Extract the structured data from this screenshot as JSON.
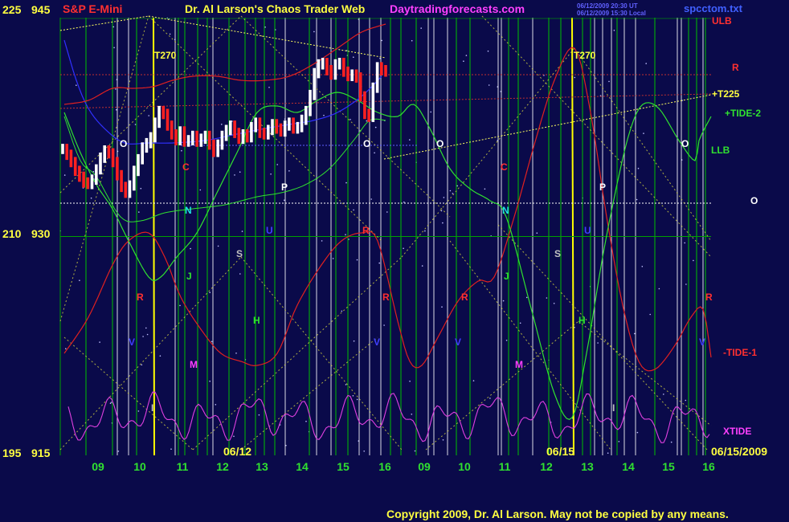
{
  "header": {
    "title_left": "S&P E-Mini",
    "title_center": "Dr. Al Larson's Chaos Trader Web",
    "site": "Daytradingforecasts.com",
    "timestamp_utc": "06/12/2009 20:30 UT",
    "timestamp_local": "06/12/2009 15:30 Local",
    "file": "spcctom.txt"
  },
  "footer": {
    "copyright": "Copyright 2009, Dr. Al Larson. May not be copied by any means."
  },
  "colors": {
    "background": "#0a0a4a",
    "price_up": "#ffffff",
    "price_down": "#ff2020",
    "tide_red": "#e02020",
    "tide_green": "#30e030",
    "tide_blue": "#3030ff",
    "xtide": "#e040e0",
    "grid_vertical_white": "#ffffff",
    "grid_vertical_green": "#00c000",
    "t270_line": "#ffff00"
  },
  "chart_data": {
    "type": "line",
    "axes": {
      "left_outer": {
        "ticks": [
          "225",
          "210",
          "195"
        ]
      },
      "left_inner": {
        "ticks": [
          "945",
          "930",
          "915"
        ]
      },
      "ylim": [
        915,
        945
      ]
    },
    "x_ticks": [
      "09",
      "10",
      "11",
      "12",
      "13",
      "14",
      "15",
      "16",
      "09",
      "10",
      "11",
      "12",
      "13",
      "14",
      "15",
      "16"
    ],
    "date_labels": [
      "06/12",
      "06/15",
      "06/15/2009"
    ],
    "right_labels": [
      "ULB",
      "R",
      "+T225",
      "+TIDE-2",
      "LLB",
      "O",
      "-TIDE-1",
      "XTIDE"
    ],
    "t270_labels": [
      "T270",
      "T270"
    ],
    "markers": {
      "day1": [
        "O",
        "C",
        "N",
        "P",
        "U",
        "S",
        "J",
        "R",
        "H",
        "V",
        "M",
        "I",
        "O",
        "R",
        "V"
      ],
      "day2": [
        "O",
        "C",
        "N",
        "R",
        "J",
        "U",
        "S",
        "P",
        "H",
        "V",
        "M",
        "I",
        "O",
        "R",
        "V",
        "R"
      ]
    },
    "series": [
      {
        "values": [
          936.0,
          935.6,
          935.1,
          934.5,
          934.1,
          933.7,
          933.6,
          933.9,
          934.6,
          935.4,
          935.9,
          935.7,
          935.1,
          934.2,
          933.4,
          933.0,
          933.5,
          934.5,
          935.3,
          936.1,
          936.4,
          936.8,
          937.8,
          938.6,
          938.4,
          937.6,
          937.0,
          936.6,
          937.2,
          936.5,
          936.6,
          936.9,
          936.5,
          936.7,
          936.9,
          936.3,
          935.8,
          936.3,
          936.9,
          937.3,
          937.6,
          937.1,
          936.7,
          937.0,
          936.8,
          937.5,
          937.8,
          937.1,
          937.0,
          937.3,
          937.7,
          937.4,
          937.2,
          937.6,
          937.8,
          937.4,
          937.5,
          938.0,
          938.6,
          939.7,
          941.2,
          941.8,
          941.9,
          941.4,
          941.1,
          941.8,
          941.9,
          941.3,
          941.0,
          941.1,
          940.9,
          939.6,
          938.4,
          938.2,
          940.2,
          941.6,
          941.4,
          941.3
        ]
      }
    ]
  }
}
